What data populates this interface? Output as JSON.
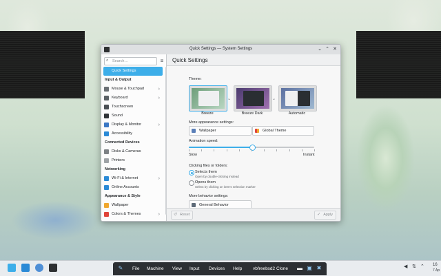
{
  "window": {
    "title": "Quick Settings — System Settings"
  },
  "sidebar": {
    "search_placeholder": "Search…",
    "sections": [
      {
        "heading": "",
        "items": [
          {
            "label": "Quick Settings",
            "icon": "quick-settings-icon",
            "color": "#3daee9"
          }
        ]
      },
      {
        "heading": "Input & Output",
        "items": [
          {
            "label": "Mouse & Touchpad",
            "icon": "mouse-icon",
            "color": "#6b7075"
          },
          {
            "label": "Keyboard",
            "icon": "keyboard-icon",
            "color": "#5b6166"
          },
          {
            "label": "Touchscreen",
            "icon": "touchscreen-icon",
            "color": "#4a4f54"
          },
          {
            "label": "Sound",
            "icon": "sound-icon",
            "color": "#2f3337"
          },
          {
            "label": "Display & Monitor",
            "icon": "display-icon",
            "color": "#3a77c4"
          },
          {
            "label": "Accessibility",
            "icon": "accessibility-icon",
            "color": "#2b8ad6"
          }
        ]
      },
      {
        "heading": "Connected Devices",
        "items": [
          {
            "label": "Disks & Cameras",
            "icon": "disks-icon",
            "color": "#7d8185"
          },
          {
            "label": "Printers",
            "icon": "printer-icon",
            "color": "#9fa3a7"
          }
        ]
      },
      {
        "heading": "Networking",
        "items": [
          {
            "label": "Wi-Fi & Internet",
            "icon": "wifi-icon",
            "color": "#2b8ad6"
          },
          {
            "label": "Online Accounts",
            "icon": "online-accounts-icon",
            "color": "#2b8ad6"
          }
        ]
      },
      {
        "heading": "Appearance & Style",
        "items": [
          {
            "label": "Wallpaper",
            "icon": "wallpaper-icon",
            "color": "#f0a830"
          },
          {
            "label": "Colors & Themes",
            "icon": "colors-icon",
            "color": "#e0453a"
          }
        ]
      }
    ]
  },
  "main": {
    "title": "Quick Settings",
    "theme_label": "Theme:",
    "themes": [
      {
        "name": "Breeze",
        "bg": "#dfe6ea",
        "accent": "#3daee9",
        "selected": true
      },
      {
        "name": "Breeze Dark",
        "bg": "#2a2e32",
        "accent": "#3daee9",
        "selected": false
      },
      {
        "name": "Automatic",
        "bg": "#cfd6dc",
        "accent": "#3daee9",
        "selected": false
      }
    ],
    "appearance_label": "More appearance settings:",
    "wallpaper_button": "Wallpaper",
    "global_theme_button": "Global Theme",
    "animation_label": "Animation speed:",
    "animation_slow": "Slow",
    "animation_instant": "Instant",
    "animation_value": 0.5,
    "clicking_label": "Clicking files or folders:",
    "option_selects": "Selects them",
    "option_selects_sub": "Open by double-clicking instead",
    "option_opens": "Opens them",
    "option_opens_sub": "Select by clicking on item's selection marker",
    "behavior_label": "More behavior settings:",
    "general_behavior_button": "General Behavior",
    "reset_button": "Reset",
    "apply_button": "Apply"
  },
  "vbox": {
    "menus": [
      "File",
      "Machine",
      "View",
      "Input",
      "Devices",
      "Help"
    ],
    "vm_name": "vbfreebsd2 Clone"
  },
  "tray": {
    "time": "16",
    "date": "7 Ap"
  }
}
